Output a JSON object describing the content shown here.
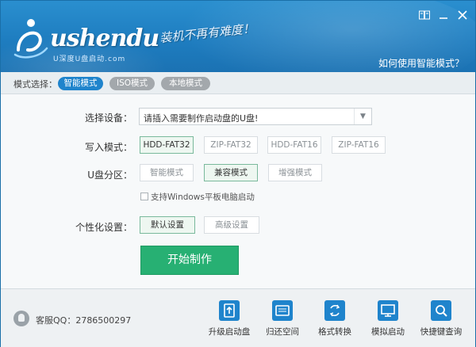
{
  "header": {
    "logo_text": "ushendu",
    "logo_sub": "U深度U盘启动.com",
    "slogan": "装机不再有难度！",
    "help_link": "如何使用智能模式？"
  },
  "mode_bar": {
    "label": "模式选择：",
    "tabs": [
      {
        "label": "智能模式",
        "active": true
      },
      {
        "label": "ISO模式",
        "active": false
      },
      {
        "label": "本地模式",
        "active": false
      }
    ]
  },
  "form": {
    "device_label": "选择设备：",
    "device_value": "请插入需要制作启动盘的U盘!",
    "write_label": "写入模式：",
    "write_options": [
      "HDD-FAT32",
      "ZIP-FAT32",
      "HDD-FAT16",
      "ZIP-FAT16"
    ],
    "partition_label": "U盘分区：",
    "partition_options": [
      "智能模式",
      "兼容模式",
      "增强模式"
    ],
    "windows_tablet": "支持Windows平板电脑启动",
    "custom_label": "个性化设置：",
    "custom_options": [
      "默认设置",
      "高级设置"
    ],
    "start_button": "开始制作"
  },
  "footer": {
    "qq": "客服QQ：2786500297",
    "tools": [
      {
        "label": "升级启动盘",
        "icon": "upgrade-icon"
      },
      {
        "label": "归还空间",
        "icon": "disk-icon"
      },
      {
        "label": "格式转换",
        "icon": "convert-icon"
      },
      {
        "label": "模拟启动",
        "icon": "monitor-icon"
      },
      {
        "label": "快捷键查询",
        "icon": "search-icon"
      }
    ]
  },
  "colors": {
    "header_blue": "#1e7dc0",
    "accent_blue": "#1f84cc",
    "start_green": "#27b073"
  }
}
